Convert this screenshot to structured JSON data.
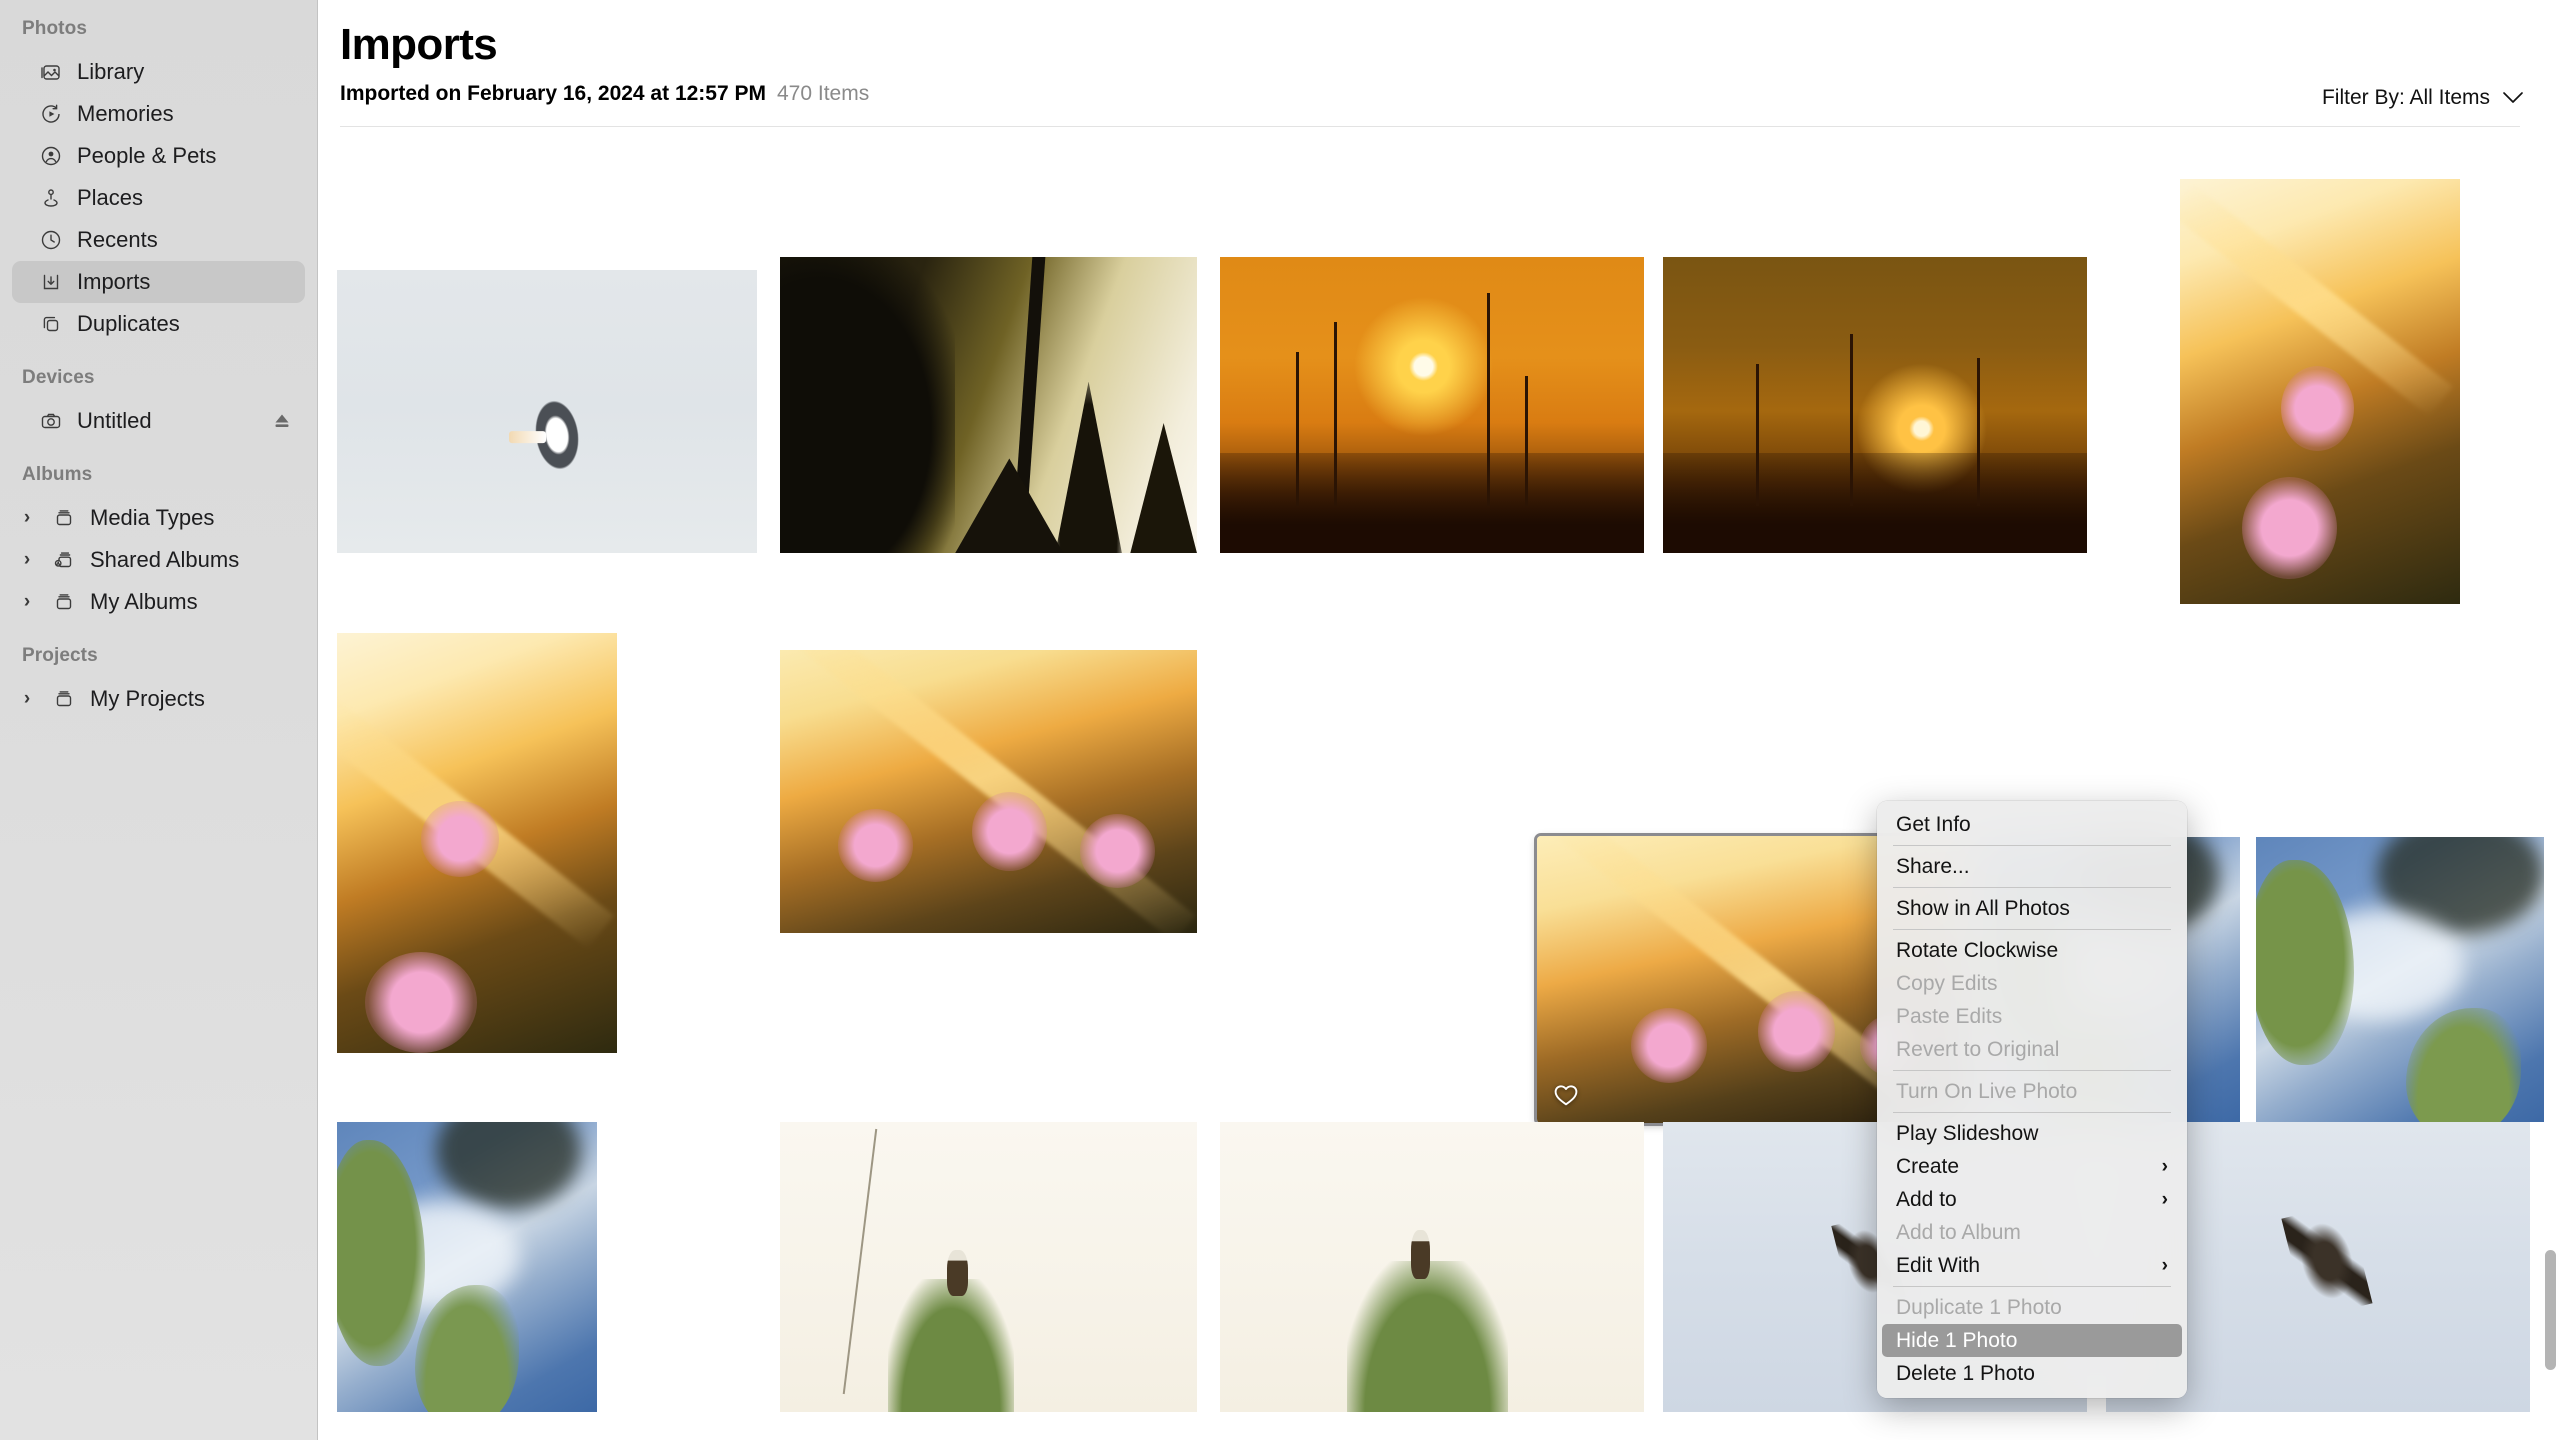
{
  "sidebar": {
    "sections": [
      {
        "title": "Photos",
        "items": [
          {
            "label": "Library",
            "icon": "library-icon",
            "selected": false
          },
          {
            "label": "Memories",
            "icon": "memories-icon",
            "selected": false
          },
          {
            "label": "People & Pets",
            "icon": "people-icon",
            "selected": false
          },
          {
            "label": "Places",
            "icon": "places-pin-icon",
            "selected": false
          },
          {
            "label": "Recents",
            "icon": "clock-icon",
            "selected": false
          },
          {
            "label": "Imports",
            "icon": "import-icon",
            "selected": true
          },
          {
            "label": "Duplicates",
            "icon": "duplicates-icon",
            "selected": false
          }
        ]
      },
      {
        "title": "Devices",
        "items": [
          {
            "label": "Untitled",
            "icon": "camera-icon",
            "selected": false,
            "eject": true
          }
        ]
      },
      {
        "title": "Albums",
        "items": [
          {
            "label": "Media Types",
            "icon": "album-icon",
            "disclosure": true
          },
          {
            "label": "Shared Albums",
            "icon": "shared-album-icon",
            "disclosure": true
          },
          {
            "label": "My Albums",
            "icon": "album-icon",
            "disclosure": true
          }
        ]
      },
      {
        "title": "Projects",
        "items": [
          {
            "label": "My Projects",
            "icon": "album-icon",
            "disclosure": true
          }
        ]
      }
    ]
  },
  "header": {
    "title": "Imports",
    "imported_on": "Imported on February 16, 2024 at 12:57 PM",
    "item_count": "470 Items",
    "filter_label": "Filter By: All Items",
    "filter_chevron": "chevron-down-icon"
  },
  "grid": {
    "photos": [
      {
        "name": "pelican-in-flight",
        "alt": "White pelican flying in pale grey sky"
      },
      {
        "name": "backlit-conifer-forest",
        "alt": "Silhouetted spruce trees against bright sky"
      },
      {
        "name": "orange-sunset-burnt-forest",
        "alt": "Bright sun over burnt forest, orange sky"
      },
      {
        "name": "deep-orange-sunset",
        "alt": "Low sun over dark burnt forest"
      },
      {
        "name": "fireweed-sunrays-tall",
        "alt": "Pink fireweed flowers with sun rays, portrait"
      },
      {
        "name": "fireweed-meadow-portrait",
        "alt": "Fireweed in golden meadow, portrait"
      },
      {
        "name": "fireweed-sunburst-wide",
        "alt": "Fireweed meadow with sunburst, landscape"
      },
      {
        "name": "fireweed-selected",
        "alt": "Fireweed at sunset - selected photo",
        "selected": true,
        "favorite": true
      },
      {
        "name": "birch-blue-sky-a",
        "alt": "Birch leaves against deep blue sky"
      },
      {
        "name": "birch-blue-sky-b",
        "alt": "Birch leaves against deep blue sky"
      },
      {
        "name": "birch-blue-sky-c",
        "alt": "Birch leaves against blue sky"
      },
      {
        "name": "bald-eagle-perched",
        "alt": "Bald eagle perched on treetop, pale sky"
      },
      {
        "name": "eagle-on-spruce",
        "alt": "Eagle perched on green spruce"
      },
      {
        "name": "juvenile-eagle-flight-a",
        "alt": "Juvenile eagle soaring in pale sky"
      },
      {
        "name": "juvenile-eagle-flight-b",
        "alt": "Juvenile eagle soaring, wings spread"
      }
    ]
  },
  "context_menu": {
    "items": [
      {
        "label": "Get Info",
        "state": "enabled",
        "separator_after": true
      },
      {
        "label": "Share...",
        "state": "enabled",
        "separator_after": true
      },
      {
        "label": "Show in All Photos",
        "state": "enabled",
        "separator_after": true
      },
      {
        "label": "Rotate Clockwise",
        "state": "enabled"
      },
      {
        "label": "Copy Edits",
        "state": "disabled"
      },
      {
        "label": "Paste Edits",
        "state": "disabled"
      },
      {
        "label": "Revert to Original",
        "state": "disabled",
        "separator_after": true
      },
      {
        "label": "Turn On Live Photo",
        "state": "disabled",
        "separator_after": true
      },
      {
        "label": "Play Slideshow",
        "state": "enabled"
      },
      {
        "label": "Create",
        "state": "enabled",
        "submenu": true
      },
      {
        "label": "Add to",
        "state": "enabled",
        "submenu": true
      },
      {
        "label": "Add to Album",
        "state": "disabled"
      },
      {
        "label": "Edit With",
        "state": "enabled",
        "submenu": true,
        "separator_after": true
      },
      {
        "label": "Duplicate 1 Photo",
        "state": "disabled"
      },
      {
        "label": "Hide 1 Photo",
        "state": "highlighted"
      },
      {
        "label": "Delete 1 Photo",
        "state": "enabled"
      }
    ],
    "submenu_arrow": "chevron-right-icon"
  },
  "colors": {
    "sidebar_bg": "#dcdcdc",
    "sidebar_selected": "#c8c8c8",
    "menu_bg": "#ececec",
    "menu_highlight": "#9a9a9a",
    "text_primary": "#131313",
    "text_secondary": "#8a8a8a",
    "selection_outline": "#8b8b8f"
  }
}
